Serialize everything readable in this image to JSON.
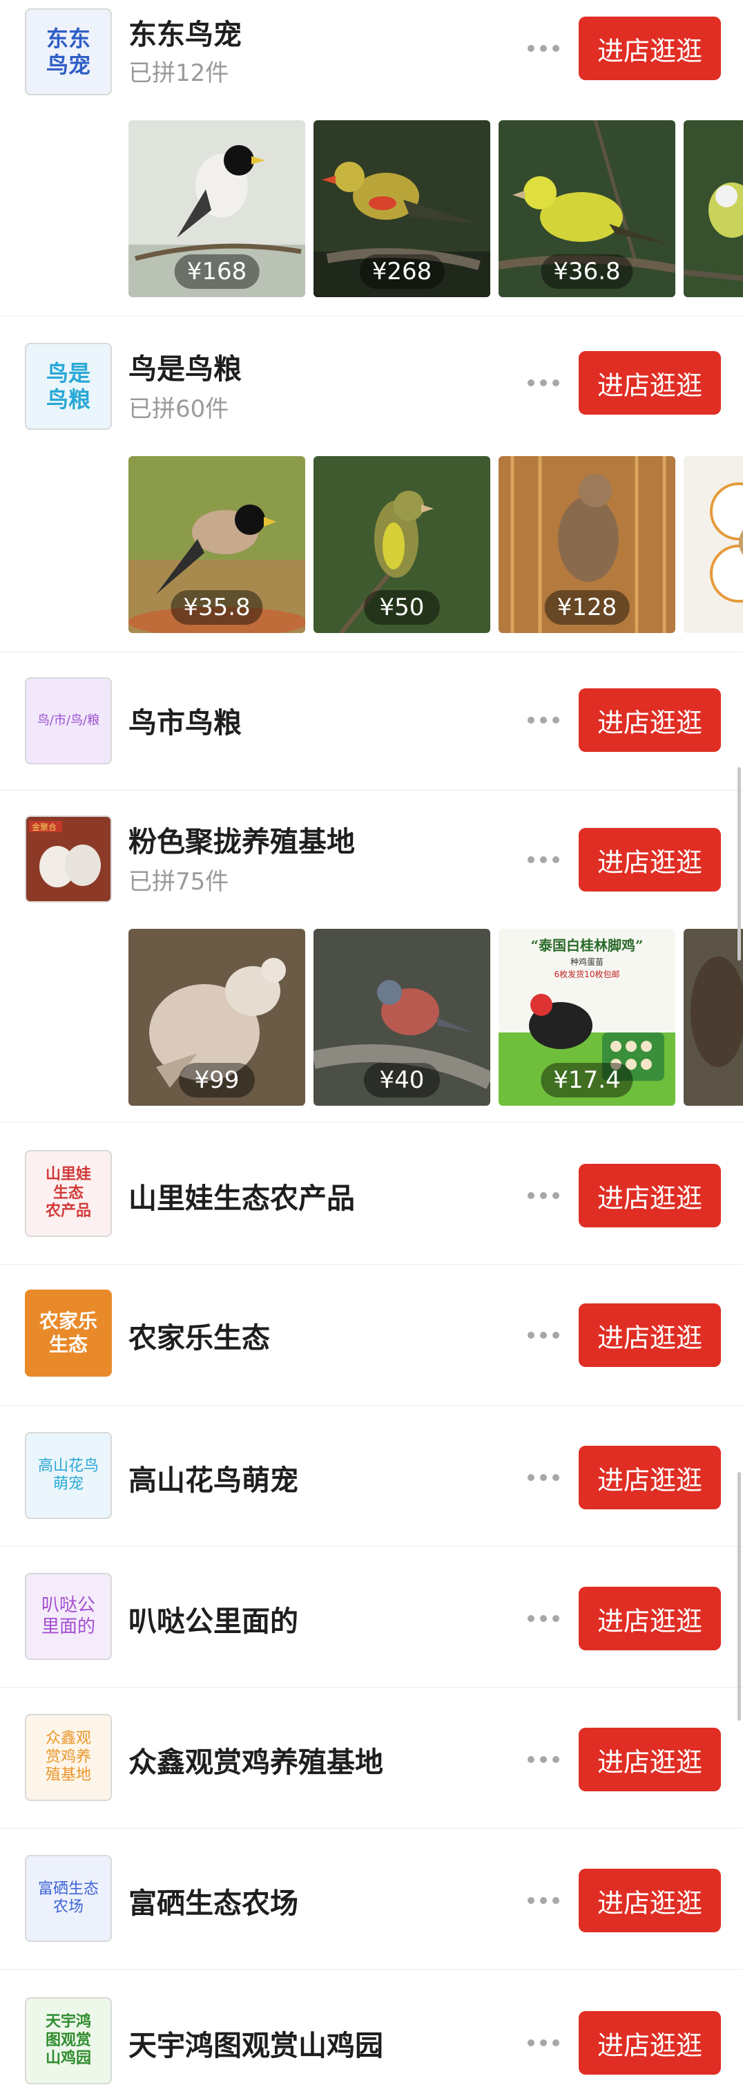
{
  "enter_label": "进店逛逛",
  "stores": [
    {
      "name": "东东鸟宠",
      "sold": "已拼12件",
      "logo_text": "东东\n鸟宠",
      "logo_bg": "#eef2fb",
      "logo_color": "#2f5fc6",
      "products": [
        {
          "price": "¥168"
        },
        {
          "price": "¥268"
        },
        {
          "price": "¥36.8"
        },
        {
          "price": ""
        }
      ]
    },
    {
      "name": "鸟是鸟粮",
      "sold": "已拼60件",
      "logo_text": "鸟是\n鸟粮",
      "logo_bg": "#eaf6fb",
      "logo_color": "#2aa8d6",
      "products": [
        {
          "price": "¥35.8"
        },
        {
          "price": "¥50"
        },
        {
          "price": "¥128"
        },
        {
          "price": "¥"
        }
      ]
    },
    {
      "name": "鸟市鸟粮",
      "sold": "",
      "logo_text": "鸟/市/鸟/粮",
      "logo_bg": "#f1e8fb",
      "logo_color": "#9b4fd0"
    },
    {
      "name": "粉色聚拢养殖基地",
      "sold": "已拼75件",
      "logo_text": "",
      "logo_bg": "#a9452e",
      "logo_color": "#ffffff",
      "products": [
        {
          "price": "¥99"
        },
        {
          "price": "¥40"
        },
        {
          "price": "¥17.4"
        },
        {
          "price": "¥"
        }
      ]
    },
    {
      "name": "山里娃生态农产品",
      "sold": "",
      "logo_text": "山里娃\n生态\n农产品",
      "logo_bg": "#fdf0f0",
      "logo_color": "#d23a3a"
    },
    {
      "name": "农家乐生态",
      "sold": "",
      "logo_text": "农家乐\n生态",
      "logo_bg": "#e98a2a",
      "logo_color": "#ffffff"
    },
    {
      "name": "高山花鸟萌宠",
      "sold": "",
      "logo_text": "高山花鸟\n萌宠",
      "logo_bg": "#eaf6fb",
      "logo_color": "#2aa8d6"
    },
    {
      "name": "叭哒公里面的",
      "sold": "",
      "logo_text": "叭哒公\n里面的",
      "logo_bg": "#f5ecfb",
      "logo_color": "#a44fd0"
    },
    {
      "name": "众鑫观赏鸡养殖基地",
      "sold": "",
      "logo_text": "众鑫观\n赏鸡养\n殖基地",
      "logo_bg": "#fdf5ea",
      "logo_color": "#e9962a"
    },
    {
      "name": "富硒生态农场",
      "sold": "",
      "logo_text": "富硒生态\n农场",
      "logo_bg": "#edf1fc",
      "logo_color": "#3e64d6"
    },
    {
      "name": "天宇鸿图观赏山鸡园",
      "sold": "",
      "logo_text": "天宇鸿\n图观赏\n山鸡园",
      "logo_bg": "#eef8ea",
      "logo_color": "#2f8c2f"
    }
  ],
  "promo_banner": {
    "title": "“泰国白桂林脚鸡”",
    "subtitle": "种鸡蛋苗",
    "tag": "6枚发货10枚包邮"
  },
  "colors": {
    "accent": "#e02e24",
    "text": "#1e1e1e",
    "muted": "#9a9a9a"
  }
}
